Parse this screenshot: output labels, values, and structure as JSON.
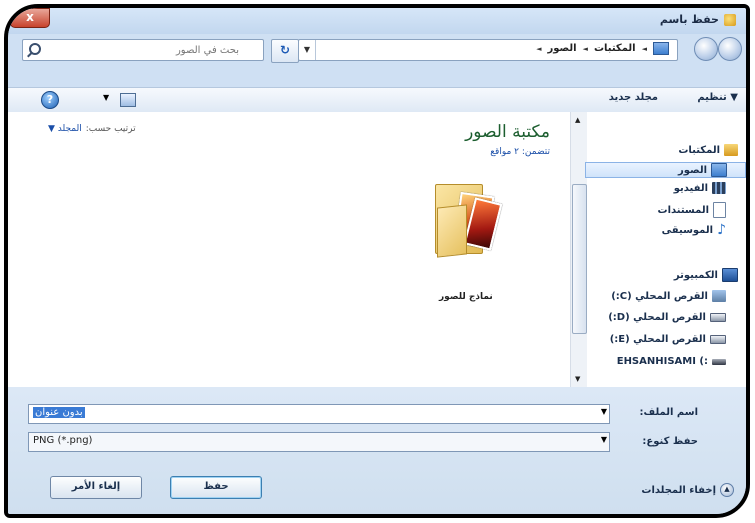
{
  "window": {
    "title": "حفظ باسم",
    "close_symbol": "x"
  },
  "nav": {
    "search_placeholder": "بحث في الصور",
    "breadcrumbs": [
      "المكتبات",
      "الصور"
    ],
    "separator": "◄",
    "dropdown_glyph": "▼"
  },
  "toolbar": {
    "organize": "تنظيم ▼",
    "new_folder": "مجلد جديد",
    "help_glyph": "?",
    "view_dropdown": "▼"
  },
  "sidebar": {
    "items": [
      {
        "label": "المكتبات"
      },
      {
        "label": "الصور"
      },
      {
        "label": "الفيديو"
      },
      {
        "label": "المستندات"
      },
      {
        "label": "الموسيقى"
      },
      {
        "label": "الكمبيوتر"
      },
      {
        "label": "القرص المحلي (C:)"
      },
      {
        "label": "القرص المحلي (D:)"
      },
      {
        "label": "القرص المحلي (E:)"
      },
      {
        "label": "EHSANHISAMI (:"
      }
    ]
  },
  "library": {
    "title": "مكتبة الصور",
    "subtitle": "تتضمن: ٢ مواقع",
    "arrange_label": "ترتيب حسب:",
    "arrange_value": "المجلد ▼",
    "folder_name": "نماذج للصور"
  },
  "form": {
    "filename_label": "اسم الملف:",
    "filename_value": "بدون عنوان",
    "filetype_label": "حفظ كنوع:",
    "filetype_value": "PNG (*.png)"
  },
  "buttons": {
    "save": "حفظ",
    "cancel": "إلغاء الأمر",
    "hide_folders": "إخفاء المجلدات"
  },
  "colors": {
    "accent": "#3a7bd5",
    "library_title": "#1c5e2f"
  }
}
